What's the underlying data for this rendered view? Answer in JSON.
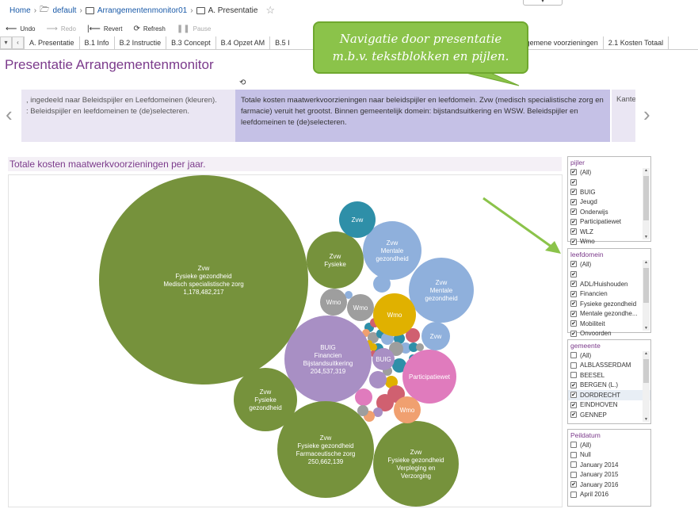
{
  "breadcrumb": {
    "home": "Home",
    "folder": "default",
    "workbook": "Arrangementenmonitor01",
    "sheet": "A. Presentatie"
  },
  "toolbar": {
    "undo": "Undo",
    "redo": "Redo",
    "revert": "Revert",
    "refresh": "Refresh",
    "pause": "Pause"
  },
  "tabs": [
    "A. Presentatie",
    "B.1 Info",
    "B.2 Instructie",
    "B.3 Concept",
    "B.4 Opzet AM",
    "B.5 I",
    "1.3 Algemene voorzieningen",
    "2.1 Kosten Totaal"
  ],
  "page_title": "Presentatie Arrangementenmonitor",
  "callout": {
    "line1": "Navigatie door presentatie",
    "line2": "m.b.v. tekstblokken en pijlen."
  },
  "story": {
    "left_line1": ", ingedeeld naar Beleidspijler en Leefdomeinen (kleuren).",
    "left_line2": ": Beleidspijler en leefdomeinen te (de)selecteren.",
    "current": "Totale kosten maatwerkvoorzieningen naar beleidspijler en leefdomein. Zvw (medisch specialistische zorg en farmacie) veruit het grootst. Binnen gemeentelijk domein: bijstandsuitkering en WSW. Beleidspijler en leefdomeinen te (de)selecteren.",
    "right": "Kante"
  },
  "chart": {
    "title": "Totale kosten maatwerkvoorzieningen per jaar.",
    "colors": {
      "green": "#76923c",
      "purple": "#a88fc4",
      "blue": "#8fb0dc",
      "teal": "#2e8fa8",
      "gray": "#9e9e9e",
      "yellow": "#e0b100",
      "pink": "#e07bbd",
      "orange": "#f0a070",
      "red": "#d06070"
    }
  },
  "chart_data": {
    "type": "bubble",
    "bubbles": [
      {
        "lines": [
          "Zvw",
          "Fysieke gezondheid",
          "Medisch specialistische zorg",
          "1,178,482,217"
        ],
        "value": 1178482217,
        "color": "green"
      },
      {
        "lines": [
          "BUIG",
          "Financien",
          "Bijstandsuitkering",
          "204,537,319"
        ],
        "value": 204537319,
        "color": "purple"
      },
      {
        "lines": [
          "Zvw",
          "Fysieke gezondheid",
          "Farmaceutische zorg",
          "250,662,139"
        ],
        "value": 250662139,
        "color": "green"
      },
      {
        "lines": [
          "Zvw",
          "Fysieke gezondheid",
          "Verpleging en",
          "Verzorging"
        ],
        "color": "green"
      },
      {
        "lines": [
          "Zvw",
          "Fysieke",
          "gezondheid"
        ],
        "color": "green"
      },
      {
        "lines": [
          "Zvw",
          "Fysieke"
        ],
        "color": "green"
      },
      {
        "lines": [
          "Zvw",
          "Mentale",
          "gezondheid"
        ],
        "color": "blue"
      },
      {
        "lines": [
          "Zvw",
          "Mentale",
          "gezondheid"
        ],
        "color": "blue"
      },
      {
        "lines": [
          "Zvw"
        ],
        "color": "teal"
      },
      {
        "lines": [
          "Participatiewet"
        ],
        "color": "pink"
      },
      {
        "lines": [
          "Wmo"
        ],
        "color": "yellow"
      },
      {
        "lines": [
          "Wmo"
        ],
        "color": "gray"
      },
      {
        "lines": [
          "Wmo"
        ],
        "color": "gray"
      },
      {
        "lines": [
          "Zvw"
        ],
        "color": "blue"
      },
      {
        "lines": [
          "Wmo"
        ],
        "color": "orange"
      },
      {
        "lines": [
          "BUIG"
        ],
        "color": "purple"
      }
    ]
  },
  "filters": {
    "pijler": {
      "title": "pijler",
      "items": [
        {
          "label": "(All)",
          "checked": true
        },
        {
          "label": "",
          "checked": true
        },
        {
          "label": "BUIG",
          "checked": true
        },
        {
          "label": "Jeugd",
          "checked": true
        },
        {
          "label": "Onderwijs",
          "checked": true
        },
        {
          "label": "Participatiewet",
          "checked": true
        },
        {
          "label": "WLZ",
          "checked": true
        },
        {
          "label": "Wmo",
          "checked": true
        }
      ]
    },
    "leefdomein": {
      "title": "leefdomein",
      "items": [
        {
          "label": "(All)",
          "checked": true
        },
        {
          "label": "",
          "checked": true
        },
        {
          "label": "ADL/Huishouden",
          "checked": true
        },
        {
          "label": "Financien",
          "checked": true
        },
        {
          "label": "Fysieke gezondheid",
          "checked": true
        },
        {
          "label": "Mentale gezondhe...",
          "checked": true
        },
        {
          "label": "Mobiliteit",
          "checked": true
        },
        {
          "label": "Onvoorden",
          "checked": true
        }
      ]
    },
    "gemeente": {
      "title": "gemeente",
      "items": [
        {
          "label": "(All)",
          "checked": false
        },
        {
          "label": "ALBLASSERDAM",
          "checked": false
        },
        {
          "label": "BEESEL",
          "checked": false
        },
        {
          "label": "BERGEN (L.)",
          "checked": true
        },
        {
          "label": "DORDRECHT",
          "checked": true
        },
        {
          "label": "EINDHOVEN",
          "checked": true
        },
        {
          "label": "GENNEP",
          "checked": true
        }
      ]
    },
    "peildatum": {
      "title": "Peildatum",
      "items": [
        {
          "label": "(All)",
          "checked": false
        },
        {
          "label": "Null",
          "checked": false
        },
        {
          "label": "January 2014",
          "checked": false
        },
        {
          "label": "January 2015",
          "checked": false
        },
        {
          "label": "January 2016",
          "checked": true
        },
        {
          "label": "April 2016",
          "checked": false
        }
      ]
    }
  }
}
